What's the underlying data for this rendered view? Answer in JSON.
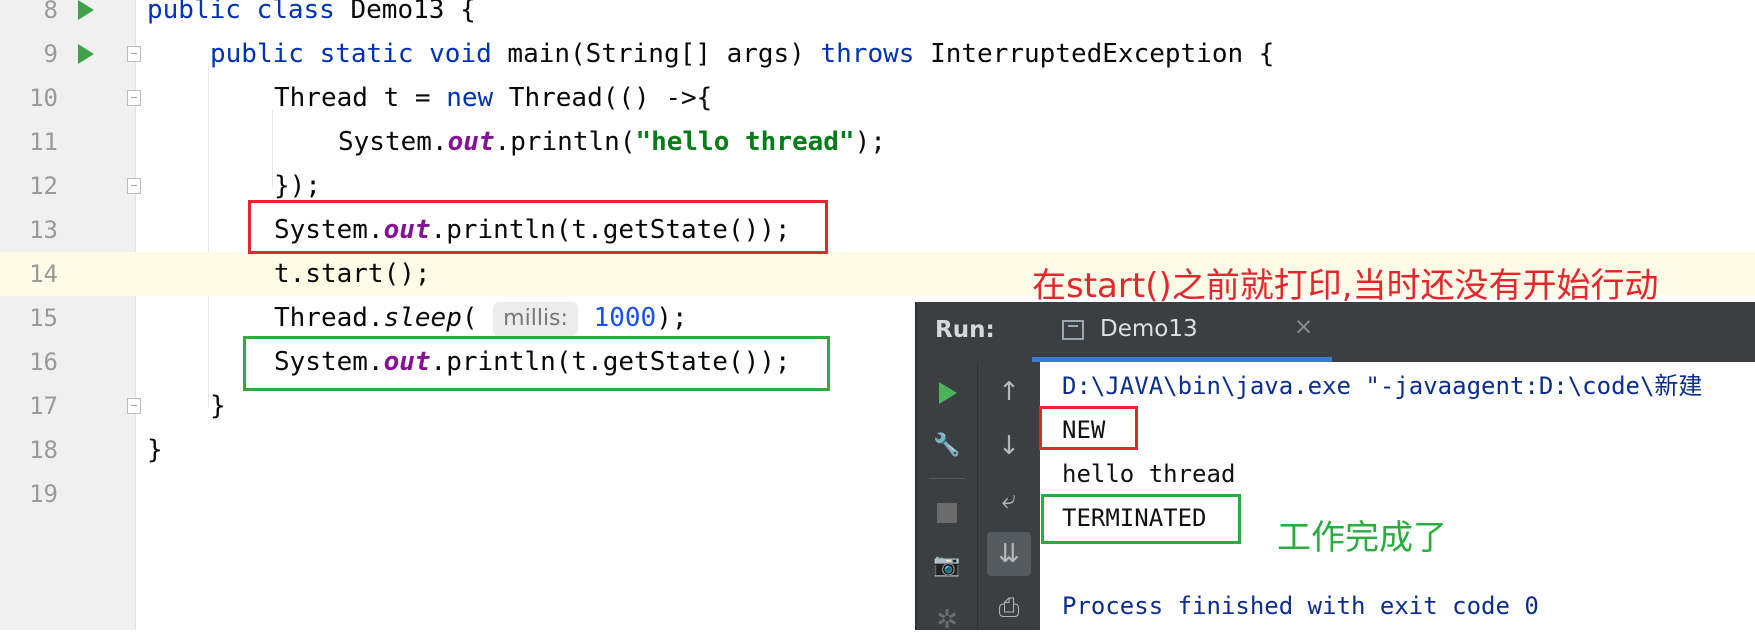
{
  "editor": {
    "lines": [
      {
        "num": "8"
      },
      {
        "num": "9"
      },
      {
        "num": "10"
      },
      {
        "num": "11"
      },
      {
        "num": "12"
      },
      {
        "num": "13"
      },
      {
        "num": "14"
      },
      {
        "num": "15"
      },
      {
        "num": "16"
      },
      {
        "num": "17"
      },
      {
        "num": "18"
      },
      {
        "num": "19"
      }
    ],
    "code": {
      "l8_kw": "public class",
      "l8_rest": " Demo13 {",
      "l9_kw1": "public static void",
      "l9_mid": " main(String[] args) ",
      "l9_kw2": "throws",
      "l9_rest": " InterruptedException {",
      "l10_a": "Thread t = ",
      "l10_kw": "new",
      "l10_b": " Thread(() ->{",
      "l11_a": "System.",
      "l11_fld": "out",
      "l11_b": ".println(",
      "l11_str": "\"hello thread\"",
      "l11_c": ");",
      "l12": "});",
      "l13_a": "System.",
      "l13_fld": "out",
      "l13_b": ".println(t.getState());",
      "l14": "t.start();",
      "l15_a": "Thread.",
      "l15_ital": "sleep",
      "l15_b": "(",
      "l15_hint": "millis:",
      "l15_num": "1000",
      "l15_c": ");",
      "l16_a": "System.",
      "l16_fld": "out",
      "l16_b": ".println(t.getState());",
      "l17": "}",
      "l18": "}"
    }
  },
  "annotations": {
    "red_note": "在start()之前就打印,当时还没有开始行动",
    "green_note": "工作完成了",
    "red_color": "#e6262e",
    "green_color": "#27ae3f"
  },
  "run_panel": {
    "label": "Run:",
    "tab_name": "Demo13",
    "tab_close": "×",
    "tools": {
      "up": "↑",
      "down": "↓",
      "wrap": "⤶",
      "scroll_end": "⇊",
      "print": "⎙",
      "wrench": "🔧",
      "camera": "📷",
      "bug": "✲"
    },
    "console": [
      "D:\\JAVA\\bin\\java.exe \"-javaagent:D:\\code\\新建",
      "NEW",
      "hello thread",
      "TERMINATED",
      "",
      "Process finished with exit code 0"
    ]
  }
}
